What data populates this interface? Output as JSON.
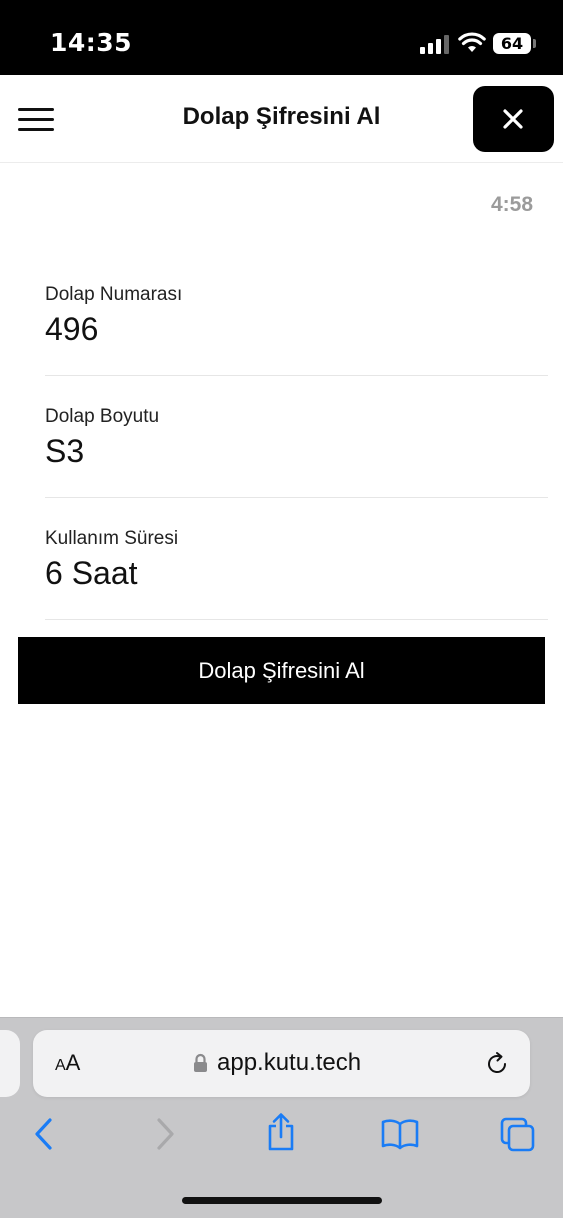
{
  "status_bar": {
    "time": "14:35",
    "battery": "64"
  },
  "header": {
    "title": "Dolap Şifresini Al",
    "menu_icon": "hamburger-menu-icon",
    "close_icon": "close-icon"
  },
  "timer": "4:58",
  "fields": [
    {
      "label": "Dolap Numarası",
      "value": "496"
    },
    {
      "label": "Dolap Boyutu",
      "value": "S3"
    },
    {
      "label": "Kullanım Süresi",
      "value": "6 Saat"
    }
  ],
  "primary_button": {
    "label": "Dolap Şifresini Al"
  },
  "browser": {
    "text_size_label_small": "A",
    "text_size_label_large": "A",
    "url": "app.kutu.tech",
    "accent_color": "#1a7cf5",
    "disabled_color": "#a9a9ab",
    "toolbar_icons": [
      "back-icon",
      "forward-icon",
      "share-icon",
      "bookmarks-icon",
      "tabs-icon"
    ]
  }
}
